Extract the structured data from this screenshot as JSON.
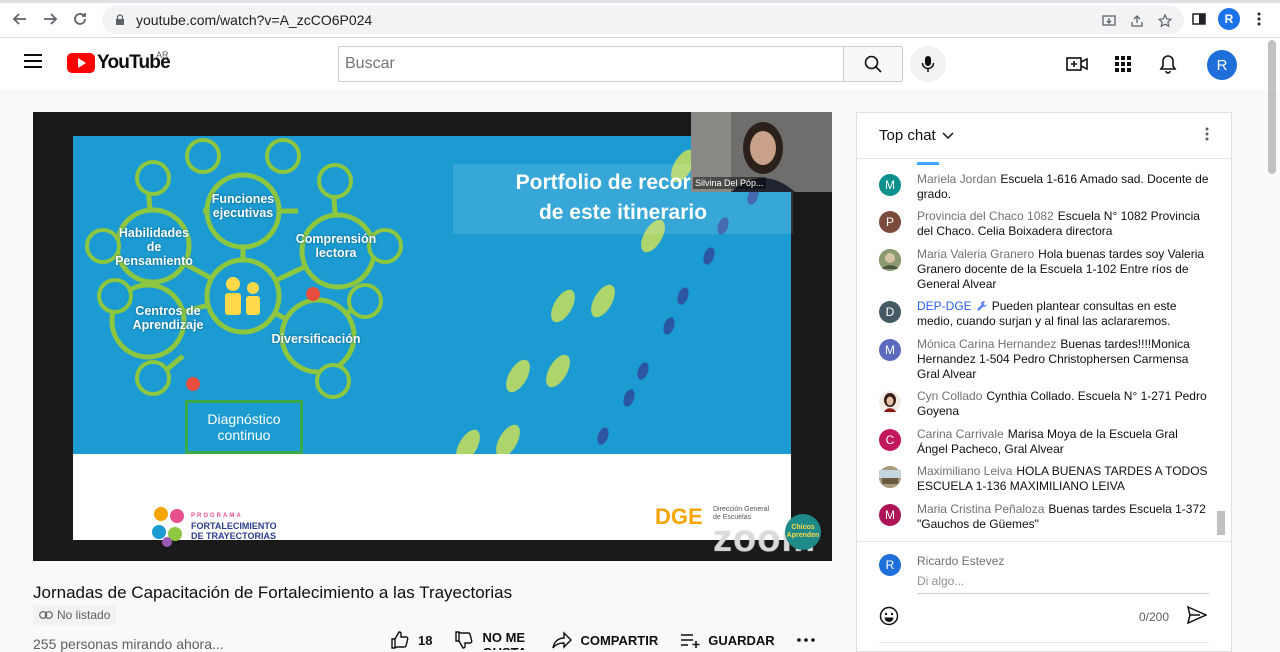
{
  "browser": {
    "url": "youtube.com/watch?v=A_zcCO6P024",
    "profile_initial": "R"
  },
  "header": {
    "logo_text": "YouTube",
    "region": "AR",
    "search_placeholder": "Buscar",
    "avatar_initial": "R"
  },
  "video": {
    "slide": {
      "title_line1": "Portfolio de recorrido",
      "title_line2": "de este itinerario",
      "nodes": {
        "funciones": "Funciones ejecutivas",
        "habilidades": "Habilidades de Pensamiento",
        "comprension": "Comprensión lectora",
        "centros": "Centros de Aprendizaje",
        "diversificacion": "Diversificación",
        "diagnostico": "Diagnóstico continuo"
      },
      "fort_l1": "PROGRAMA",
      "fort_l2": "FORTALECIMIENTO",
      "fort_l3": "DE TRAYECTORIAS",
      "dge": "DGE",
      "dge_l1": "Dirección General",
      "dge_l2": "de Escuelas",
      "zoom": "zoom",
      "badge": "Chicos Aprenden"
    },
    "participant_name": "Silvina Del Póp...",
    "title": "Jornadas de Capacitación de Fortalecimiento a las Trayectorias",
    "unlisted": "No listado",
    "viewers": "255 personas mirando ahora...",
    "likes": "18",
    "dislike": "NO ME GUSTA",
    "share": "COMPARTIR",
    "save": "GUARDAR"
  },
  "chat": {
    "header": "Top chat",
    "messages": [
      {
        "initial": "M",
        "color": "#0b8f8f",
        "author": "Mariela Jordan",
        "text": "Escuela 1-616 Amado sad. Docente de grado."
      },
      {
        "initial": "P",
        "color": "#7a4a3a",
        "author": "Provincia del Chaco 1082",
        "text": "Escuela N° 1082 Provincia del Chaco. Celia Boixadera directora"
      },
      {
        "initial": "",
        "color": "#6b7a5a",
        "author": "Maria Valeria Granero",
        "text": "Hola buenas tardes soy Valeria Granero docente de la Escuela 1-102 Entre ríos de General Alvear"
      },
      {
        "initial": "D",
        "color": "#455a64",
        "author": "DEP-DGE",
        "text": "Pueden plantear consultas en este medio, cuando surjan y al final las aclararemos."
      },
      {
        "initial": "M",
        "color": "#5c6bc0",
        "author": "Mónica Carina Hernandez",
        "text": "Buenas tardes!!!!Monica Hernandez 1-504 Pedro Christophersen Carmensa Gral Alvear"
      },
      {
        "initial": "",
        "color": "#8b1a1a",
        "author": "Cyn Collado",
        "text": "Cynthia Collado. Escuela N° 1-271 Pedro Goyena"
      },
      {
        "initial": "C",
        "color": "#c2185b",
        "author": "Carina Carrivale",
        "text": "Marisa Moya de la Escuela Gral Ángel Pacheco, Gral Alvear"
      },
      {
        "initial": "",
        "color": "#8a7a60",
        "author": "Maximiliano Leiva",
        "text": "HOLA BUENAS TARDES A TODOS ESCUELA 1-136 MAXIMILIANO LEIVA"
      },
      {
        "initial": "M",
        "color": "#ad1457",
        "author": "Maria Cristina Peñaloza",
        "text": "Buenas tardes Escuela 1-372 \"Gauchos de Güemes\""
      }
    ],
    "input_author": "Ricardo Estevez",
    "input_initial": "R",
    "input_placeholder": "Di algo...",
    "char_count": "0/200"
  }
}
